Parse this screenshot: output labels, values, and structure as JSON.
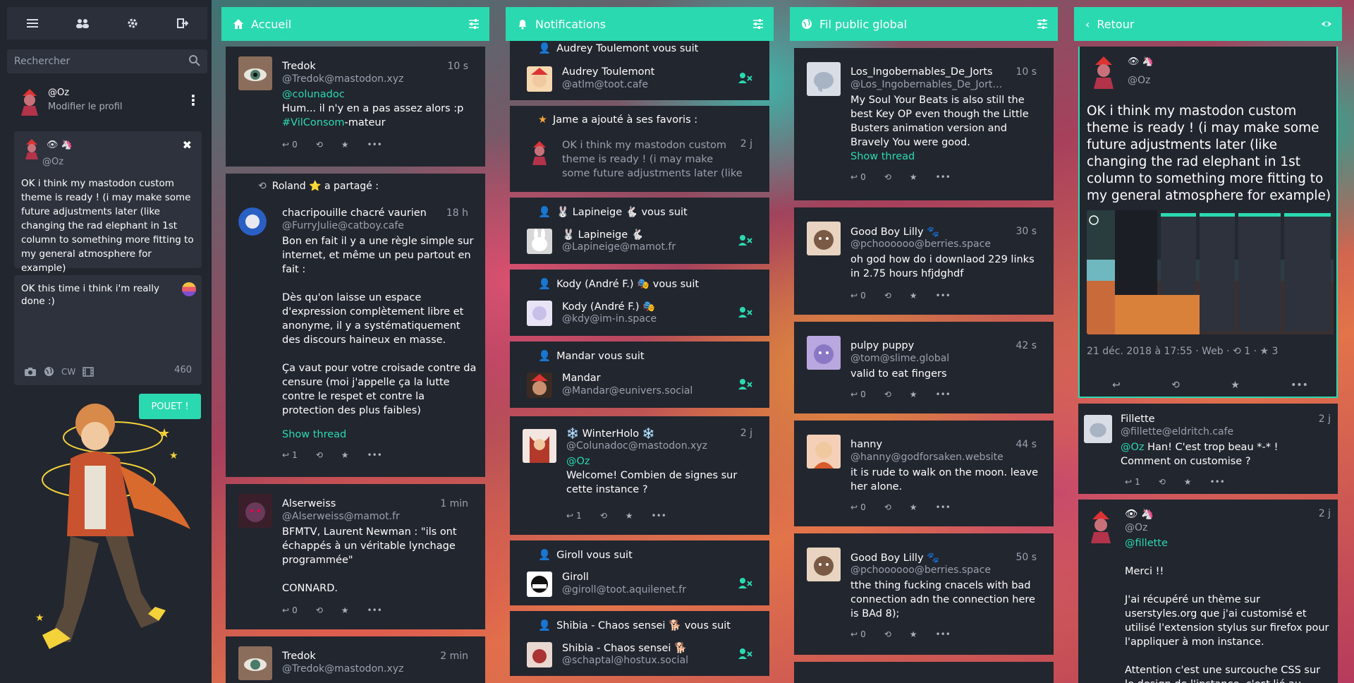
{
  "sidebar": {
    "nav": [
      {
        "icon": "hamburger-icon"
      },
      {
        "icon": "people-icon"
      },
      {
        "icon": "gear-icon"
      },
      {
        "icon": "logout-icon"
      }
    ],
    "search": {
      "placeholder": "Rechercher"
    },
    "account": {
      "name": "@Oz",
      "edit": "Modifier le profil"
    },
    "reply": {
      "emojis": "👁 🦄",
      "handle": "@Oz",
      "text": "OK i think my mastodon custom theme is ready ! (i may make some future adjustments later (like changing the rad elephant in 1st column to something more fitting to my general atmosphere for example)"
    },
    "compose": {
      "text": "OK this time i think i'm really done :)",
      "cw": "CW",
      "count": "460",
      "button": "POUET !"
    }
  },
  "columns": {
    "home": {
      "title": "Accueil"
    },
    "notifications": {
      "title": "Notifications"
    },
    "public": {
      "title": "Fil public global"
    },
    "detail": {
      "title": "Retour"
    }
  },
  "home": [
    {
      "name": "Tredok",
      "handle": "@Tredok@mastodon.xyz",
      "time": "10 s",
      "mention": "@colunadoc",
      "body": "Hum... il n'y en a pas assez alors :p",
      "tag": "#VilConsom",
      "tagrest": "-mateur",
      "replies": "0"
    },
    {
      "booster": "Roland ⭐ a partagé :",
      "name": "chacripouille chacré vaurien",
      "handle": "@FurryJulie@catboy.cafe",
      "time": "18 h",
      "p1": "Bon en fait il y a une règle simple sur internet, et même un peu partout en fait :",
      "p2": "Dès qu'on laisse un espace d'expression complètement libre et anonyme, il y a systématiquement des discours haineux en masse.",
      "p3": "Ça vaut pour votre croisade contre da censure (moi j'appelle ça la lutte contre le respet et contre la protection des plus faibles)",
      "show": "Show thread",
      "replies": "1"
    },
    {
      "name": "Alserweiss",
      "handle": "@Alserweiss@mamot.fr",
      "time": "1 min",
      "p1": "BFMTV, Laurent Newman : \"ils ont échappés à un véritable lynchage programmée\"",
      "p2": "CONNARD.",
      "replies": "0"
    },
    {
      "name": "Tredok",
      "handle": "@Tredok@mastodon.xyz",
      "time": "2 min"
    }
  ],
  "notifications": [
    {
      "line": "Audrey Toulemont vous suit",
      "name": "Audrey Toulemont",
      "handle": "@atlm@toot.cafe"
    },
    {
      "line": "Jame a ajouté à ses favoris :",
      "body": "OK i think my mastodon custom theme is ready ! (i may make some future adjustments later (like",
      "time": "2 j"
    },
    {
      "line": "🐰 Lapineige 🐇 vous suit",
      "name": "🐰 Lapineige 🐇",
      "handle": "@Lapineige@mamot.fr"
    },
    {
      "line": "Kody (André F.) 🎭 vous suit",
      "name": "Kody (André F.) 🎭",
      "handle": "@kdy@im-in.space"
    },
    {
      "line": "Mandar vous suit",
      "name": "Mandar",
      "handle": "@Mandar@eunivers.social"
    },
    {
      "name": "❄️ WinterHolo ❄️",
      "handle": "@Colunadoc@mastodon.xyz",
      "time": "2 j",
      "mention": "@Oz",
      "body": "Welcome! Combien de signes sur cette instance ?",
      "replies": "1"
    },
    {
      "line": "Giroll vous suit",
      "name": "Giroll",
      "handle": "@giroll@toot.aquilenet.fr"
    },
    {
      "line": "Shibia - Chaos sensei 🐕 vous suit",
      "name": "Shibia - Chaos sensei 🐕",
      "handle": "@schaptal@hostux.social"
    }
  ],
  "public": [
    {
      "name": "Los_Ingobernables_De_Jorts",
      "handle": "@Los_Ingobernables_De_Jorts@j...",
      "time": "10 s",
      "body": "My Soul Your Beats is also still the best Key OP even though the Little Busters animation version and Bravely You were good.",
      "show": "Show thread",
      "replies": "0"
    },
    {
      "name": "Good Boy Lilly 🐾",
      "handle": "@pchoooooo@berries.space",
      "time": "30 s",
      "body": "oh god how do i downlaod 229 links in 2.75 hours hfjdghdf",
      "replies": "0"
    },
    {
      "name": "pulpy puppy",
      "handle": "@tom@slime.global",
      "time": "42 s",
      "body": "valid to eat fingers",
      "replies": "0"
    },
    {
      "name": "hanny",
      "handle": "@hanny@godforsaken.website",
      "time": "44 s",
      "body": "it is rude to walk on the moon. leave her alone.",
      "replies": "0"
    },
    {
      "name": "Good Boy Lilly 🐾",
      "handle": "@pchoooooo@berries.space",
      "time": "50 s",
      "body": "tthe thing fucking cnacels with bad connection adn the connection here is BAd 8);",
      "replies": "0"
    }
  ],
  "detail": {
    "emojis": "👁 🦄",
    "handle": "@Oz",
    "text": "OK i think my mastodon custom theme is ready ! (i may make some future adjustments later (like changing the rad elephant in 1st column to something more fitting to my general atmosphere for example)",
    "meta": "21 déc. 2018 à 17:55 · Web · ⟲ 1 · ★ 3",
    "replies": [
      {
        "name": "Fillette",
        "handle": "@fillette@eldritch.cafe",
        "time": "2 j",
        "mention": "@Oz",
        "body": "Han! C'est trop beau *-* ! Comment on customise ?",
        "replies": "1"
      },
      {
        "emojis": "👁 🦄",
        "handle": "@Oz",
        "time": "2 j",
        "mention": "@fillette",
        "p1": "Merci !!",
        "p2": "J'ai récupéré un thème sur userstyles.org que j'ai customisé et utilisé l'extension stylus sur firefox pour l'appliquer à mon instance.",
        "p3": "Attention c'est une surcouche CSS sur le design de l'instance, c'est lié au"
      }
    ]
  },
  "colors": {
    "accent": "#2bd9b1",
    "card": "#22262f",
    "sidebar": "#22262f"
  }
}
